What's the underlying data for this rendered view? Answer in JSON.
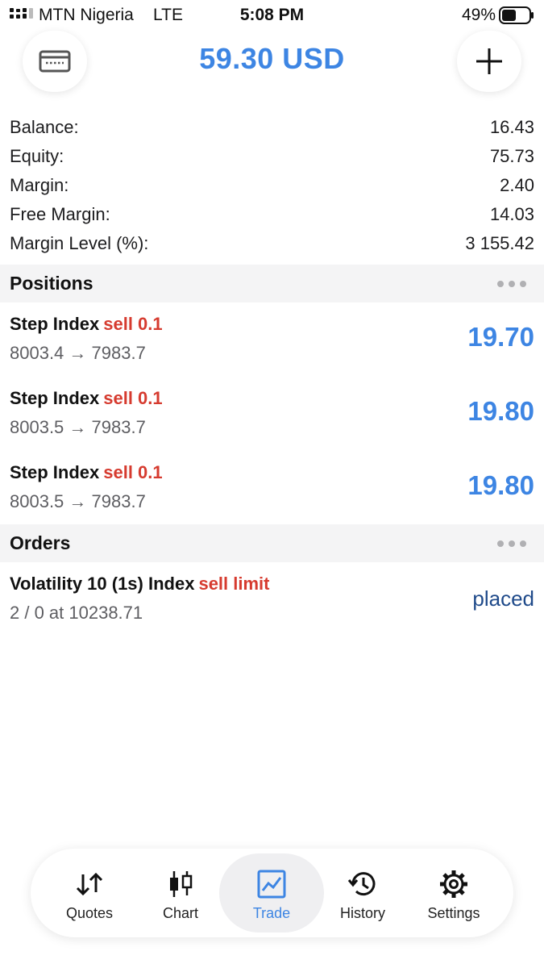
{
  "status_bar": {
    "carrier": "MTN Nigeria",
    "network": "LTE",
    "time": "5:08 PM",
    "battery_percent": "49%"
  },
  "header": {
    "equity_title": "59.30 USD",
    "left_icon": "card-icon",
    "right_icon": "plus-icon"
  },
  "summary": [
    {
      "label": "Balance:",
      "value": "16.43"
    },
    {
      "label": "Equity:",
      "value": "75.73"
    },
    {
      "label": "Margin:",
      "value": "2.40"
    },
    {
      "label": "Free Margin:",
      "value": "14.03"
    },
    {
      "label": "Margin Level (%):",
      "value": "3 155.42"
    }
  ],
  "positions": {
    "title": "Positions",
    "items": [
      {
        "symbol": "Step Index",
        "direction": "sell 0.1",
        "prices": "8003.4 → 7983.7",
        "profit": "19.70"
      },
      {
        "symbol": "Step Index",
        "direction": "sell 0.1",
        "prices": "8003.5 → 7983.7",
        "profit": "19.80"
      },
      {
        "symbol": "Step Index",
        "direction": "sell 0.1",
        "prices": "8003.5 → 7983.7",
        "profit": "19.80"
      }
    ]
  },
  "orders": {
    "title": "Orders",
    "items": [
      {
        "symbol": "Volatility 10 (1s) Index",
        "direction": "sell limit",
        "details": "2 / 0 at 10238.71",
        "status": "placed"
      }
    ]
  },
  "tabs": [
    {
      "label": "Quotes",
      "icon": "quotes-arrows-icon",
      "active": false
    },
    {
      "label": "Chart",
      "icon": "candlestick-chart-icon",
      "active": false
    },
    {
      "label": "Trade",
      "icon": "trade-chart-icon",
      "active": true
    },
    {
      "label": "History",
      "icon": "history-clock-icon",
      "active": false
    },
    {
      "label": "Settings",
      "icon": "gear-icon",
      "active": false
    }
  ],
  "colors": {
    "accent_blue": "#3d85e3",
    "sell_red": "#d63b2f",
    "placed_blue": "#1f4a8a"
  }
}
